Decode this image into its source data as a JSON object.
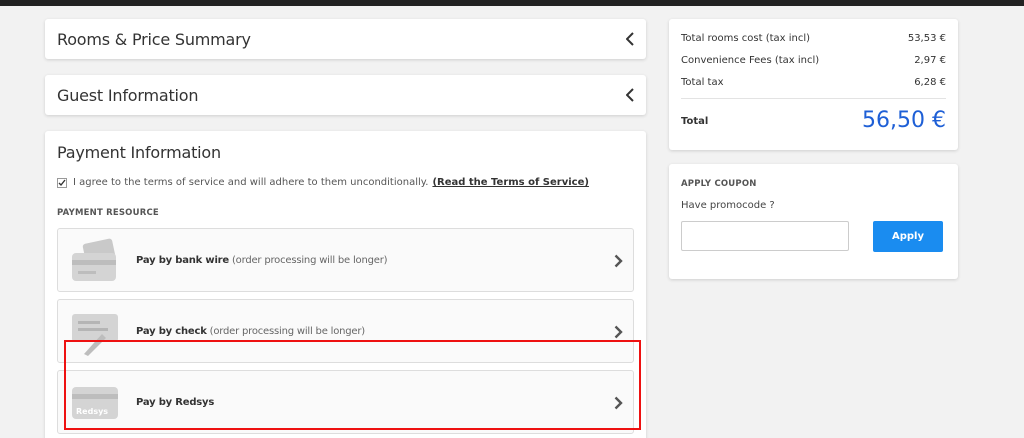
{
  "sections": {
    "rooms_summary": "Rooms & Price Summary",
    "guest_info": "Guest Information",
    "payment_info": "Payment Information"
  },
  "terms": {
    "text": "I agree to the terms of service and will adhere to them unconditionally.",
    "link": "(Read the Terms of Service)",
    "checked": true
  },
  "payment_resource_label": "PAYMENT RESOURCE",
  "methods": [
    {
      "name": "Pay by bank wire",
      "note": " (order processing will be longer)",
      "icon": "bank-card-icon"
    },
    {
      "name": "Pay by check",
      "note": " (order processing will be longer)",
      "icon": "check-pen-icon"
    },
    {
      "name": "Pay by Redsys",
      "note": "",
      "icon": "redsys-card-icon",
      "icon_text": "Redsys"
    }
  ],
  "summary": {
    "rows": [
      {
        "label": "Total rooms cost (tax incl)",
        "value": "53,53 €"
      },
      {
        "label": "Convenience Fees (tax incl)",
        "value": "2,97 €"
      },
      {
        "label": "Total tax",
        "value": "6,28 €"
      }
    ],
    "total_label": "Total",
    "total_value": "56,50 €"
  },
  "coupon": {
    "title": "APPLY COUPON",
    "prompt": "Have promocode ?",
    "input_value": "",
    "button": "Apply"
  },
  "colors": {
    "accent": "#1a8cf0",
    "total": "#1e5fd6",
    "highlight": "#e11111"
  }
}
